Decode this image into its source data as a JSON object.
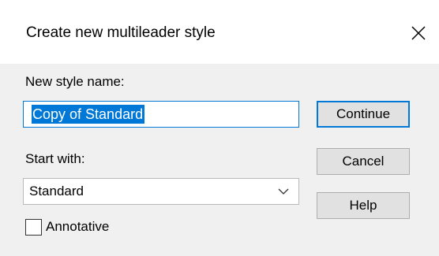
{
  "dialog": {
    "title": "Create new multileader style",
    "close_icon": "close-icon"
  },
  "form": {
    "name_label": "New style name:",
    "name_value": "Copy of Standard",
    "start_label": "Start with:",
    "start_value": "Standard",
    "annotative_label": "Annotative",
    "annotative_checked": false
  },
  "buttons": {
    "continue": "Continue",
    "cancel": "Cancel",
    "help": "Help"
  },
  "colors": {
    "accent": "#0078d7",
    "body_background": "#f0f0f0",
    "button_face": "#e1e1e1"
  }
}
